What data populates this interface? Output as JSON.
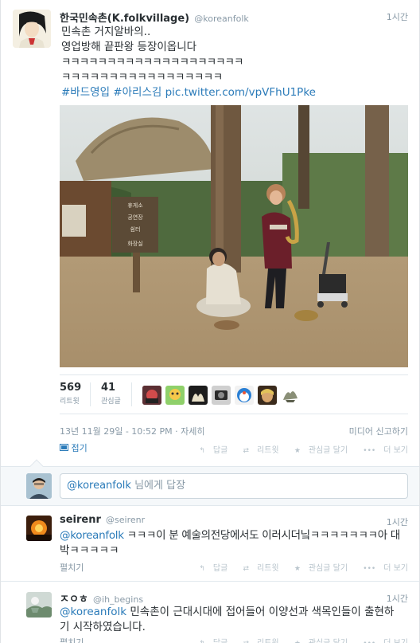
{
  "tweet": {
    "fullname": "한국민속촌(K.folkvillage)",
    "handle": "@koreanfolk",
    "time": "1시간",
    "lines": [
      "민속촌 거지알바의..",
      "영업방해 끝판왕 등장이옵니다",
      "ㅋㅋㅋㅋㅋㅋㅋㅋㅋㅋㅋㅋㅋㅋㅋㅋㅋㅋㅋㅋ",
      "ㅋㅋㅋㅋㅋㅋㅋㅋㅋㅋㅋㅋㅋㅋㅋㅋㅋ"
    ],
    "hashtags": [
      "#바드영입",
      "#아리스김"
    ],
    "pic_link": "pic.twitter.com/vpVFhU1Pke",
    "stats": {
      "retweets": "569",
      "retweets_label": "리트윗",
      "favorites": "41",
      "favorites_label": "관심글"
    },
    "timestamp": "13년 11월 29일 - 10:52 PM",
    "detail_link": "자세히",
    "report_label": "미디어 신고하기",
    "collapse_label": "접기",
    "actions": {
      "reply": "답글",
      "retweet": "리트윗",
      "favorite": "관심글 달기",
      "more": "더 보기"
    },
    "photo_signs": [
      "휴게소",
      "공연장",
      "쉼터",
      "화장실"
    ]
  },
  "reply_box": {
    "mention": "@koreanfolk",
    "placeholder_suffix": "님에게 답장"
  },
  "replies": [
    {
      "fullname": "seirenr",
      "handle": "@seirenr",
      "time": "1시간",
      "mention": "@koreanfolk",
      "line1": " ㅋㅋㅋ이 분 예술의전당에서도 이러시더닠ㅋㅋㅋㅋㅋㅋㅋ아 대",
      "line2": "박ㅋㅋㅋㅋㅋ",
      "expand": "펼치기"
    },
    {
      "fullname": "ㅈㅇㅎ",
      "handle": "@ih_begins",
      "time": "1시간",
      "mention": "@koreanfolk",
      "line1": " 민속촌이 근대시대에 접어들어 이양선과 색목인들이 출현하",
      "line2": "기 시작하였습니다.",
      "expand": "펼치기"
    }
  ],
  "icons": {
    "collapse": "media-icon",
    "reply": "reply-icon",
    "retweet": "retweet-icon",
    "favorite": "star-icon",
    "more": "more-dots-icon"
  },
  "colors": {
    "link": "#2b7bb9",
    "muted": "#8899a6",
    "border": "#e1e8ed"
  }
}
